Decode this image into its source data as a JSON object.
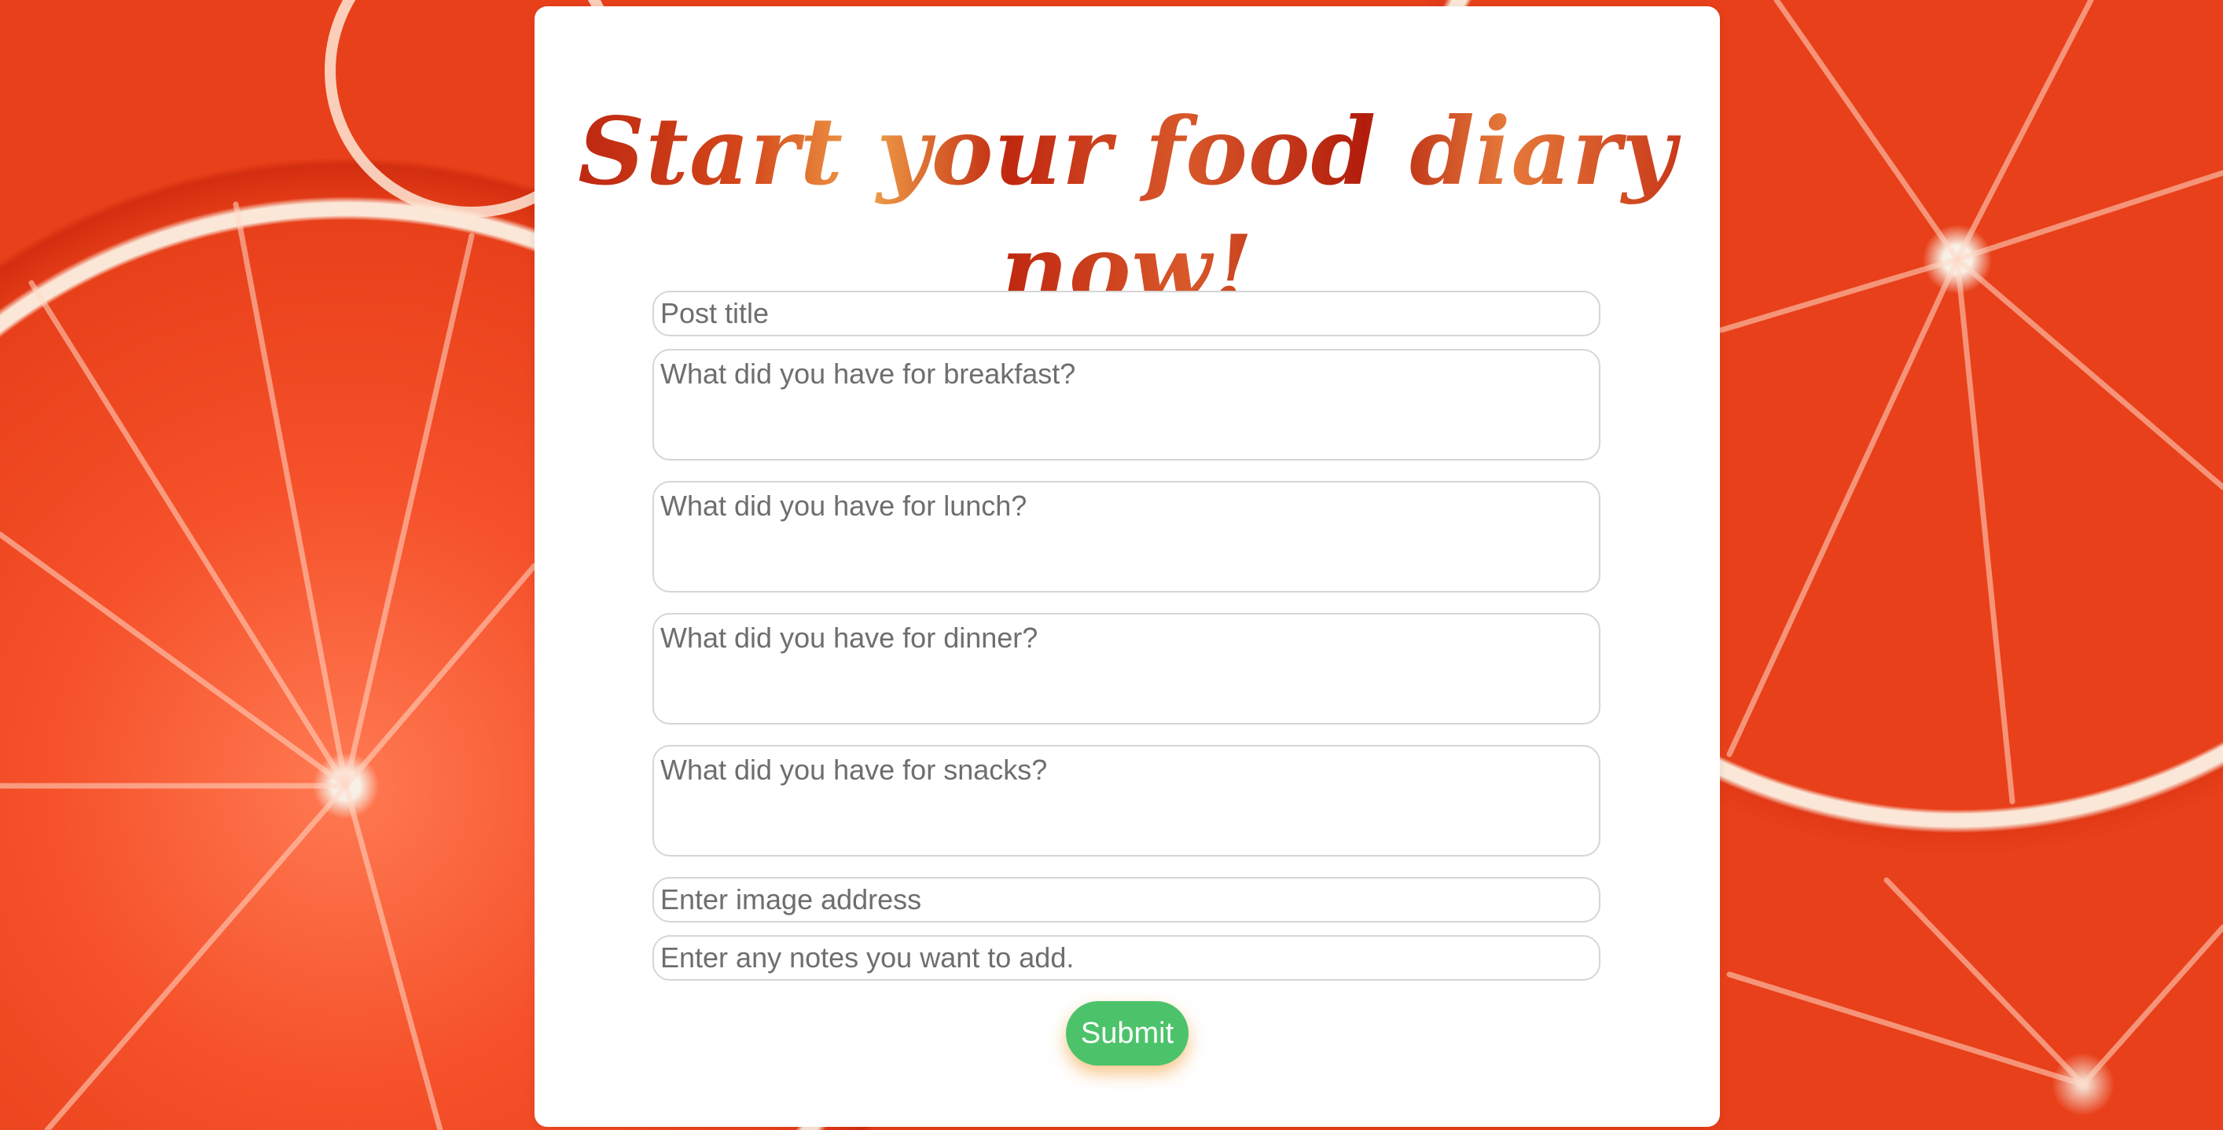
{
  "page": {
    "heading": "Start your food diary now!",
    "background_subject": "grapefruit-slices"
  },
  "form": {
    "post_title_placeholder": "Post title",
    "breakfast_placeholder": "What did you have for breakfast?",
    "lunch_placeholder": "What did you have for lunch?",
    "dinner_placeholder": "What did you have for dinner?",
    "snacks_placeholder": "What did you have for snacks?",
    "image_placeholder": "Enter image address",
    "notes_placeholder": "Enter any notes you want to add.",
    "submit_label": "Submit"
  },
  "colors": {
    "background": "#e8441e",
    "card": "#ffffff",
    "heading": "#c8391a",
    "submit_button": "#4cc36a",
    "submit_glow": "#f09628",
    "field_border": "#d6d6d6",
    "placeholder_text": "#6e6e6e"
  }
}
